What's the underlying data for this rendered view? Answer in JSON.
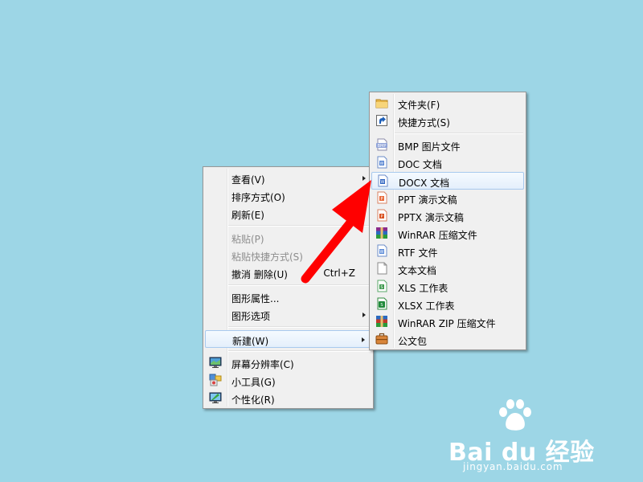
{
  "desktop_menu": {
    "items": [
      {
        "label": "查看(V)",
        "submenu": true
      },
      {
        "label": "排序方式(O)"
      },
      {
        "label": "刷新(E)"
      },
      {
        "label": "粘贴(P)",
        "disabled": true
      },
      {
        "label": "粘贴快捷方式(S)",
        "disabled": true
      },
      {
        "label": "撤消 删除(U)",
        "shortcut": "Ctrl+Z"
      },
      {
        "label": "图形属性..."
      },
      {
        "label": "图形选项",
        "submenu": true
      },
      {
        "label": "新建(W)",
        "submenu": true,
        "highlighted": true
      },
      {
        "label": "屏幕分辨率(C)"
      },
      {
        "label": "小工具(G)"
      },
      {
        "label": "个性化(R)"
      }
    ]
  },
  "new_submenu": {
    "items": [
      {
        "label": "文件夹(F)",
        "icon": "folder-icon"
      },
      {
        "label": "快捷方式(S)",
        "icon": "shortcut-icon"
      },
      {
        "label": "BMP 图片文件",
        "icon": "bmp-file-icon"
      },
      {
        "label": "DOC 文档",
        "icon": "doc-file-icon"
      },
      {
        "label": "DOCX 文档",
        "icon": "docx-file-icon",
        "highlighted": true
      },
      {
        "label": "PPT 演示文稿",
        "icon": "ppt-file-icon"
      },
      {
        "label": "PPTX 演示文稿",
        "icon": "pptx-file-icon"
      },
      {
        "label": "WinRAR 压缩文件",
        "icon": "winrar-icon"
      },
      {
        "label": "RTF 文件",
        "icon": "rtf-file-icon"
      },
      {
        "label": "文本文档",
        "icon": "text-file-icon"
      },
      {
        "label": "XLS 工作表",
        "icon": "xls-file-icon"
      },
      {
        "label": "XLSX 工作表",
        "icon": "xlsx-file-icon"
      },
      {
        "label": "WinRAR ZIP 压缩文件",
        "icon": "winrar-zip-icon"
      },
      {
        "label": "公文包",
        "icon": "briefcase-icon"
      }
    ]
  },
  "watermark": {
    "brand": "Bai du 经验",
    "url": "jingyan.baidu.com"
  },
  "colors": {
    "desktop_background": "#9dd6e6",
    "annotation_arrow": "#ff0000",
    "highlight_border": "#a8c9ee"
  }
}
